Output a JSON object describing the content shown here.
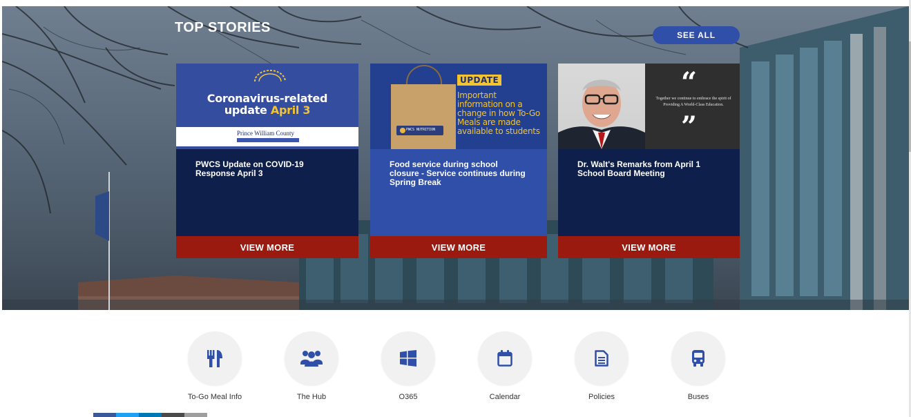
{
  "top_stories": {
    "title": "TOP STORIES",
    "see_all_label": "SEE ALL"
  },
  "cards": [
    {
      "thumb_line1": "Coronavirus-related",
      "thumb_line2_prefix": "update ",
      "thumb_line2_highlight": "April 3",
      "thumb_logo_text": "Prince William County",
      "title": "PWCS Update on COVID-19 Response April 3",
      "more_label": "VIEW MORE"
    },
    {
      "thumb_badge": "UPDATE",
      "thumb_text": "Important information on a change in how To-Go Meals are made available to students",
      "thumb_bag_label": "PWCS NUTRITION",
      "title": "Food service during school closure - Service continues during Spring Break",
      "more_label": "VIEW MORE"
    },
    {
      "thumb_quote_open": "“",
      "thumb_quote_close": "”",
      "thumb_quote_text": "Together we continue to embrace the spirit of Providing A World-Class Education.",
      "title": "Dr. Walt's Remarks from April 1 School Board Meeting",
      "more_label": "VIEW MORE"
    }
  ],
  "quick_links": [
    {
      "label": "To-Go Meal Info",
      "icon": "utensils-icon"
    },
    {
      "label": "The Hub",
      "icon": "users-icon"
    },
    {
      "label": "O365",
      "icon": "windows-icon"
    },
    {
      "label": "Calendar",
      "icon": "calendar-icon"
    },
    {
      "label": "Policies",
      "icon": "document-icon"
    },
    {
      "label": "Buses",
      "icon": "bus-icon"
    }
  ],
  "colors": {
    "accent_blue": "#2f4fa8",
    "navy": "#0f1f4b",
    "view_more_red": "#9a1a10",
    "icon_blue": "#2f4fa8",
    "highlight_yellow": "#f4c430"
  }
}
